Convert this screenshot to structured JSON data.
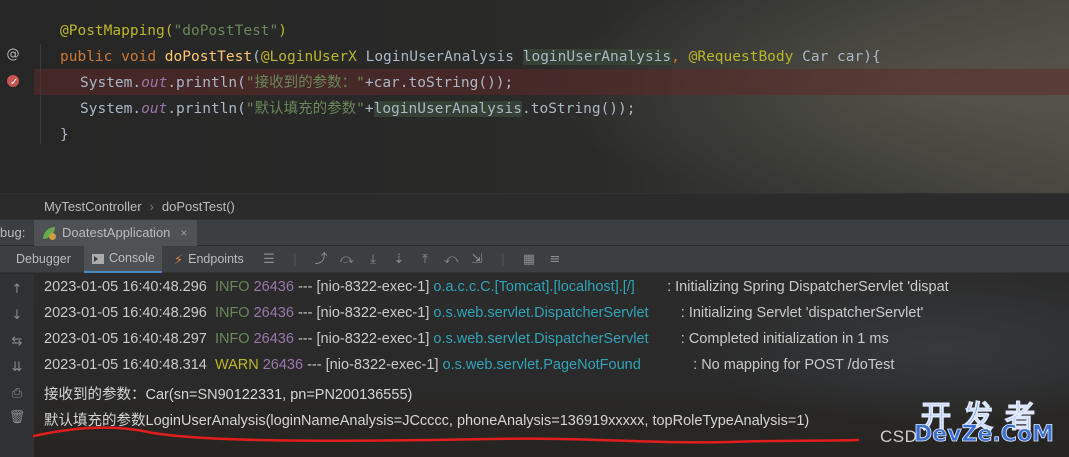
{
  "editor": {
    "line1": {
      "annotation": "@PostMapping(",
      "arg": "\"doPostTest\"",
      "close": ")"
    },
    "line2": {
      "kw_public": "public",
      "kw_void": "void",
      "method": "doPostTest",
      "paren_open": "(",
      "ann1": "@LoginUserX",
      "type1": " LoginUserAnalysis ",
      "param1": "loginUserAnalysis",
      "comma": ", ",
      "ann2": "@RequestBody",
      "type2": " Car car){"
    },
    "line3": {
      "pre": "System.",
      "field": "out",
      "call": ".println(",
      "str": "\"接收到的参数：\"",
      "rest": "+car.toString());"
    },
    "line4": {
      "pre": "System.",
      "field": "out",
      "call": ".println(",
      "str": "\"默认填充的参数\"",
      "plus": "+",
      "var": "loginUserAnalysis",
      "rest": ".toString());"
    },
    "line5": "}",
    "gutter_at": "@"
  },
  "breadcrumb": {
    "class_name": "MyTestController",
    "separator": "›",
    "method_name": "doPostTest()"
  },
  "debug": {
    "label": "bug:",
    "app_tab": "DoatestApplication",
    "close": "×"
  },
  "toolbar": {
    "debugger": "Debugger",
    "console": "Console",
    "endpoints": "Endpoints"
  },
  "console": {
    "logs": [
      {
        "ts": "2023-01-05 16:40:48.296",
        "level": "INFO",
        "pid": "26436",
        "sep": "---",
        "thread": "[nio-8322-exec-1]",
        "logger": "o.a.c.c.C.[Tomcat].[localhost].[/]",
        "msg": ": Initializing Spring DispatcherServlet 'dispat"
      },
      {
        "ts": "2023-01-05 16:40:48.296",
        "level": "INFO",
        "pid": "26436",
        "sep": "---",
        "thread": "[nio-8322-exec-1]",
        "logger": "o.s.web.servlet.DispatcherServlet",
        "msg": ": Initializing Servlet 'dispatcherServlet'"
      },
      {
        "ts": "2023-01-05 16:40:48.297",
        "level": "INFO",
        "pid": "26436",
        "sep": "---",
        "thread": "[nio-8322-exec-1]",
        "logger": "o.s.web.servlet.DispatcherServlet",
        "msg": ": Completed initialization in 1 ms"
      },
      {
        "ts": "2023-01-05 16:40:48.314",
        "level": "WARN",
        "pid": "26436",
        "sep": "---",
        "thread": "[nio-8322-exec-1]",
        "logger": "o.s.web.servlet.PageNotFound",
        "msg": ": No mapping for POST /doTest"
      }
    ],
    "output1": "接收到的参数：Car(sn=SN90122331, pn=PN200136555)",
    "output2": "默认填充的参数LoginUserAnalysis(loginNameAnalysis=JCcccc, phoneAnalysis=136919xxxxx, topRoleTypeAnalysis=1)"
  },
  "watermark": {
    "csdn": "CSD",
    "cn": "开发者",
    "en": "DevZe.CoM"
  },
  "colors": {
    "accent": "#4a88c7",
    "breakpoint": "#c75450",
    "annotation": "#bbb529",
    "string": "#6a8759",
    "keyword": "#cc7832"
  },
  "icons": {
    "up": "arrow-up-icon",
    "down": "arrow-down-icon",
    "wrap": "soft-wrap-icon",
    "scroll": "scroll-to-end-icon",
    "print": "print-icon",
    "trash": "clear-all-icon"
  }
}
